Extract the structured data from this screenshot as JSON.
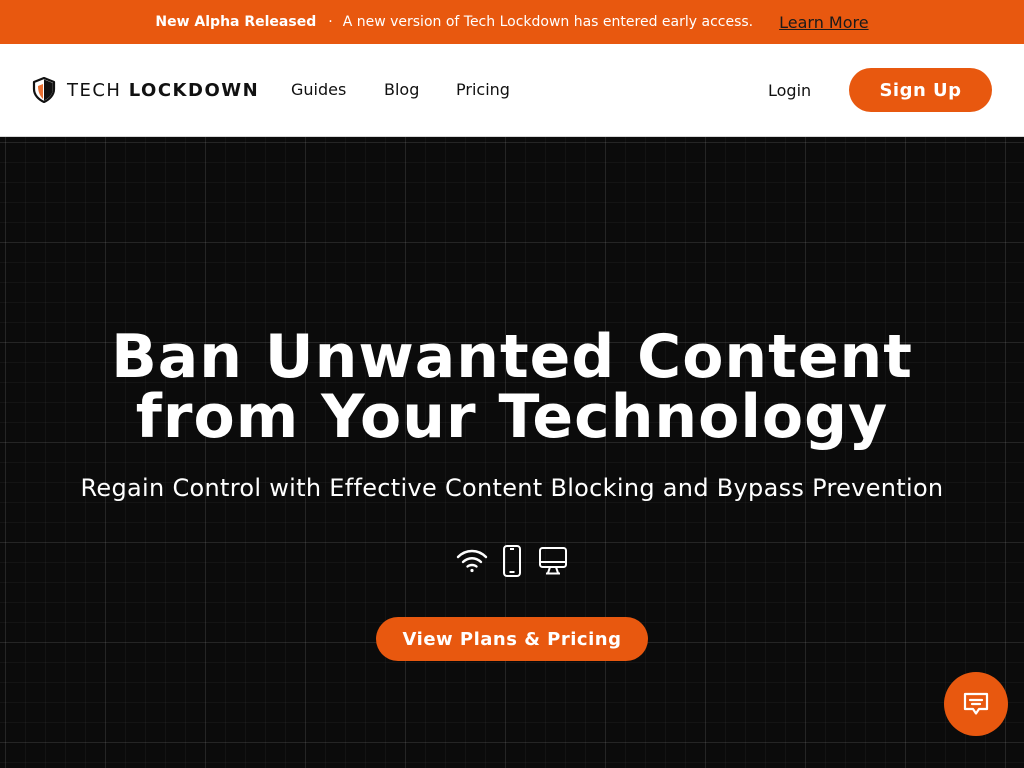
{
  "colors": {
    "accent": "#e8580f",
    "hero_bg": "#0b0b0b",
    "nav_bg": "#ffffff"
  },
  "banner": {
    "title": "New Alpha Released",
    "separator": "·",
    "message": "A new version of Tech Lockdown has entered early access.",
    "link": "Learn More"
  },
  "nav": {
    "logo_icon": "shield-icon",
    "logo_light": "TECH",
    "logo_bold": "LOCKDOWN",
    "links": [
      {
        "label": "Guides"
      },
      {
        "label": "Blog"
      },
      {
        "label": "Pricing"
      }
    ],
    "login": "Login",
    "signup": "Sign Up"
  },
  "hero": {
    "title_line1": "Ban Unwanted Content",
    "title_line2": "from Your Technology",
    "subtitle": "Regain Control with Effective Content Blocking and Bypass Prevention",
    "icons": [
      "wifi-icon",
      "smartphone-icon",
      "desktop-icon"
    ],
    "cta": "View Plans & Pricing"
  },
  "chat": {
    "icon": "chat-icon"
  }
}
